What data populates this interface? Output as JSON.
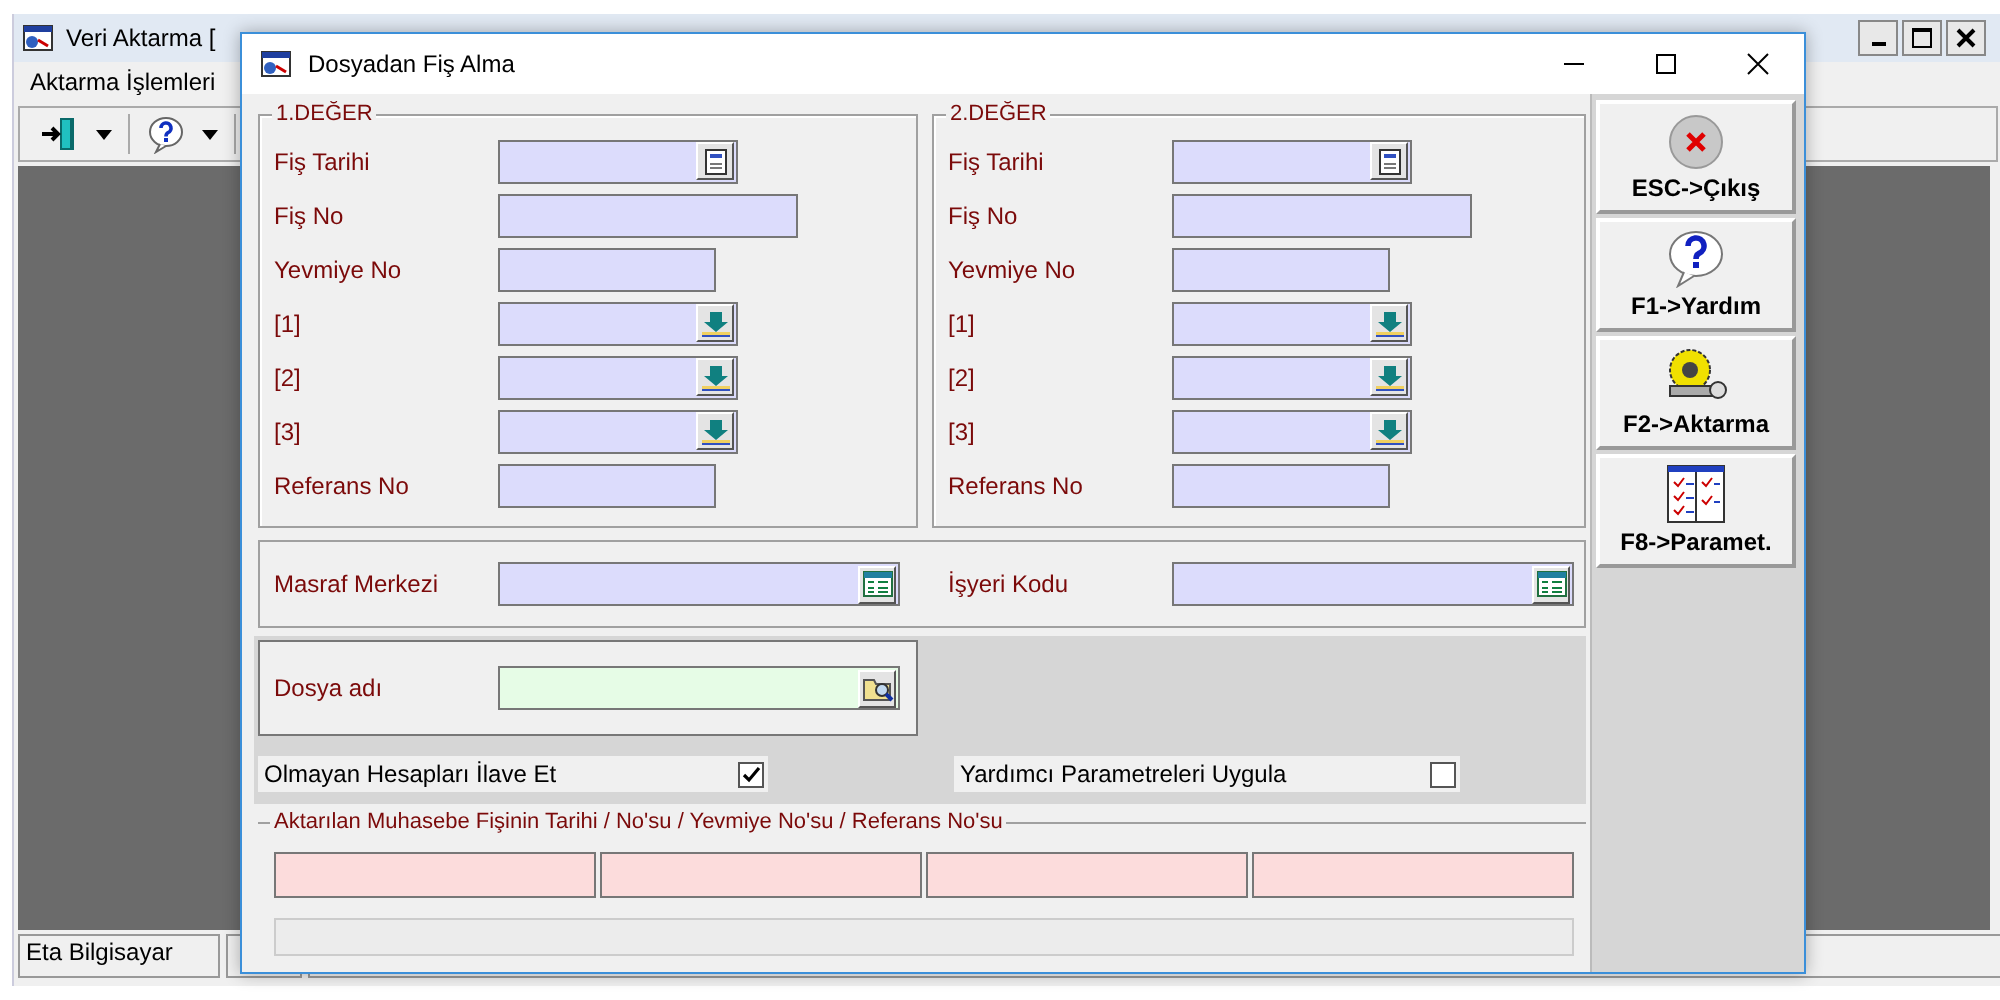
{
  "main_window": {
    "title": "Veri Aktarma [",
    "menu": [
      "Aktarma İşlemleri"
    ],
    "toolbar": [
      {
        "kind": "exit"
      },
      {
        "kind": "help"
      }
    ],
    "status_bar": [
      "Eta Bilgisayar"
    ]
  },
  "dialog": {
    "title": "Dosyadan Fiş Alma",
    "groups": [
      {
        "title": "1.DEĞER",
        "fields": [
          {
            "label": "Fiş Tarihi",
            "kind": "date"
          },
          {
            "label": "Fiş No",
            "kind": "long"
          },
          {
            "label": "Yevmiye No",
            "kind": "short"
          },
          {
            "label": "[1]",
            "kind": "pick"
          },
          {
            "label": "[2]",
            "kind": "pick"
          },
          {
            "label": "[3]",
            "kind": "pick"
          },
          {
            "label": "Referans No",
            "kind": "short"
          }
        ]
      },
      {
        "title": "2.DEĞER",
        "fields": [
          {
            "label": "Fiş Tarihi",
            "kind": "date"
          },
          {
            "label": "Fiş No",
            "kind": "long"
          },
          {
            "label": "Yevmiye No",
            "kind": "short"
          },
          {
            "label": "[1]",
            "kind": "pick"
          },
          {
            "label": "[2]",
            "kind": "pick"
          },
          {
            "label": "[3]",
            "kind": "pick"
          },
          {
            "label": "Referans No",
            "kind": "short"
          }
        ]
      }
    ],
    "lookups": [
      {
        "label": "Masraf Merkezi",
        "kind": "list"
      },
      {
        "label": "İşyeri Kodu",
        "kind": "list"
      }
    ],
    "file_field": {
      "label": "Dosya adı",
      "kind": "file"
    },
    "options": [
      {
        "label": "Olmayan Hesapları İlave Et",
        "checked": true
      },
      {
        "label": "Yardımcı Parametreleri Uygula",
        "checked": false
      }
    ],
    "result_group": {
      "title": "Aktarılan Muhasebe Fişinin Tarihi / No'su / Yevmiye No'su / Referans No'su",
      "progress": {
        "level": 0
      }
    },
    "buttons": [
      {
        "label": "ESC->Çıkış",
        "kind": "exit"
      },
      {
        "label": "F1->Yardım",
        "kind": "help"
      },
      {
        "label": "F2->Aktarma",
        "kind": "transfer"
      },
      {
        "label": "F8->Paramet.",
        "kind": "params"
      }
    ]
  }
}
